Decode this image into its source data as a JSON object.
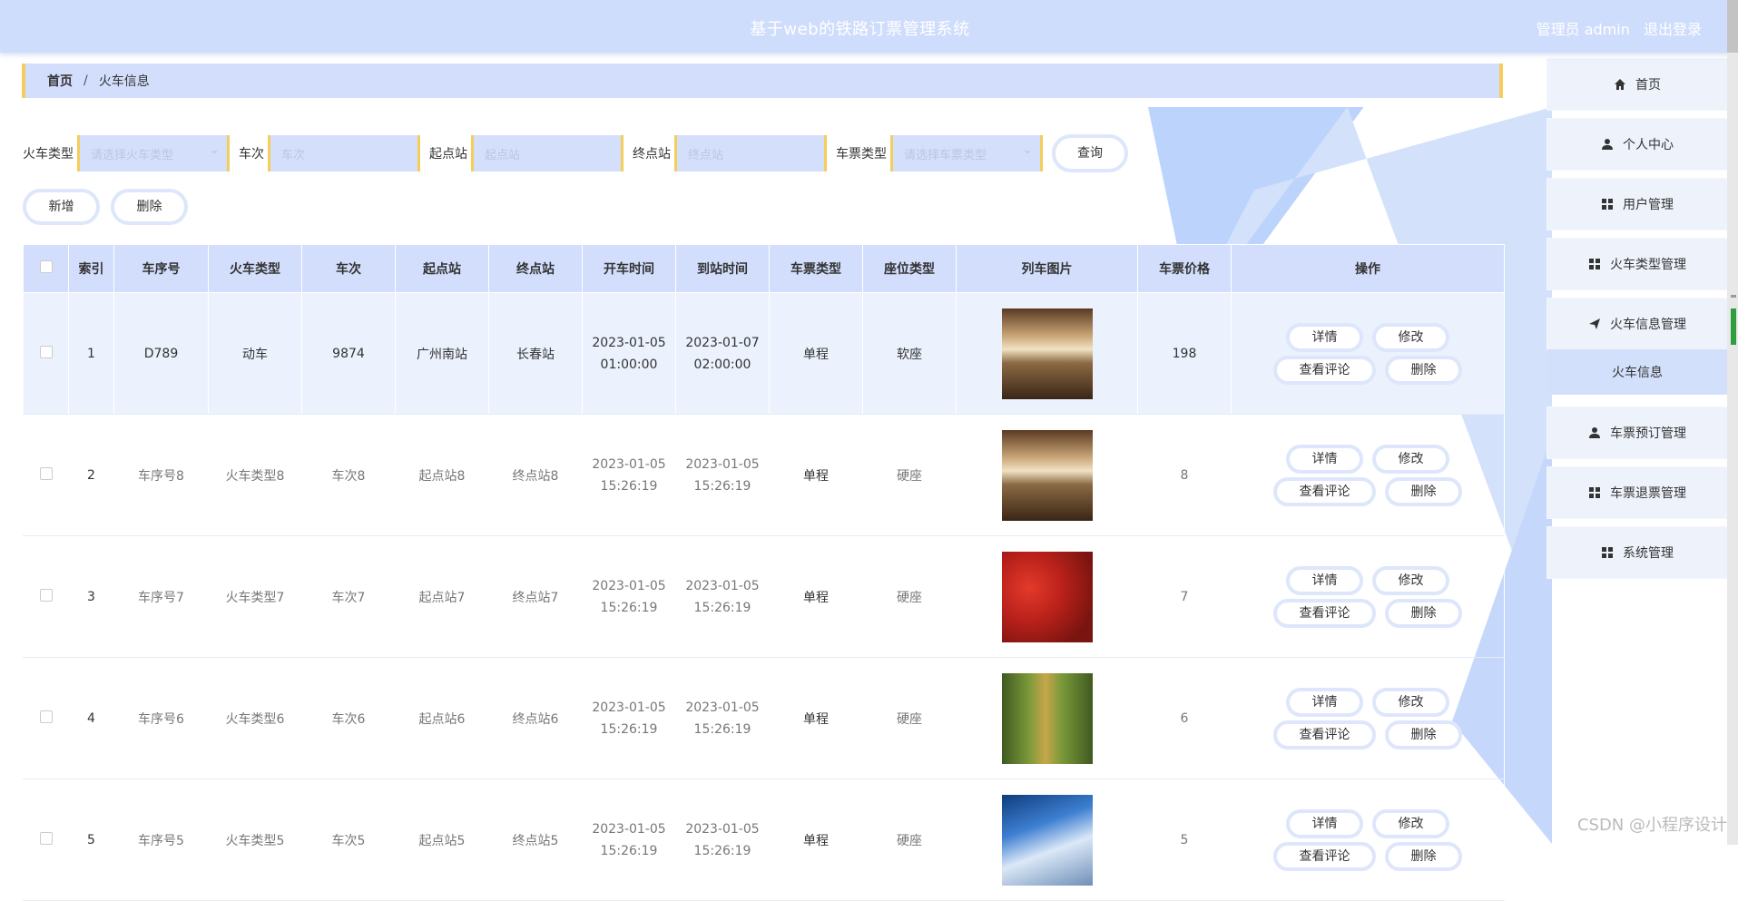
{
  "header": {
    "title": "基于web的铁路订票管理系统",
    "user_label": "管理员 admin",
    "logout_label": "退出登录"
  },
  "breadcrumb": {
    "home": "首页",
    "separator": "/",
    "current": "火车信息"
  },
  "search": {
    "train_type_label": "火车类型",
    "train_type_placeholder": "请选择火车类型",
    "train_no_label": "车次",
    "train_no_placeholder": "车次",
    "start_label": "起点站",
    "start_placeholder": "起点站",
    "end_label": "终点站",
    "end_placeholder": "终点站",
    "ticket_type_label": "车票类型",
    "ticket_type_placeholder": "请选择车票类型",
    "query_label": "查询"
  },
  "actions": {
    "add_label": "新增",
    "delete_label": "删除"
  },
  "table": {
    "headers": [
      "索引",
      "车序号",
      "火车类型",
      "车次",
      "起点站",
      "终点站",
      "开车时间",
      "到站时间",
      "车票类型",
      "座位类型",
      "列车图片",
      "车票价格",
      "操作"
    ],
    "rows": [
      {
        "index": "1",
        "serial": "D789",
        "train_type": "动车",
        "code": "9874",
        "start": "广州南站",
        "end": "长春站",
        "depart_date": "2023-01-05",
        "depart_time": "01:00:00",
        "arrive_date": "2023-01-07",
        "arrive_time": "02:00:00",
        "ticket_type": "单程",
        "seat_type": "软座",
        "image": "train-interior",
        "price": "198"
      },
      {
        "index": "2",
        "serial": "车序号8",
        "train_type": "火车类型8",
        "code": "车次8",
        "start": "起点站8",
        "end": "终点站8",
        "depart_date": "2023-01-05",
        "depart_time": "15:26:19",
        "arrive_date": "2023-01-05",
        "arrive_time": "15:26:19",
        "ticket_type": "单程",
        "seat_type": "硬座",
        "image": "train-interior",
        "price": "8"
      },
      {
        "index": "3",
        "serial": "车序号7",
        "train_type": "火车类型7",
        "code": "车次7",
        "start": "起点站7",
        "end": "终点站7",
        "depart_date": "2023-01-05",
        "depart_time": "15:26:19",
        "arrive_date": "2023-01-05",
        "arrive_time": "15:26:19",
        "ticket_type": "单程",
        "seat_type": "硬座",
        "image": "train-red-forest",
        "price": "7"
      },
      {
        "index": "4",
        "serial": "车序号6",
        "train_type": "火车类型6",
        "code": "车次6",
        "start": "起点站6",
        "end": "终点站6",
        "depart_date": "2023-01-05",
        "depart_time": "15:26:19",
        "arrive_date": "2023-01-05",
        "arrive_time": "15:26:19",
        "ticket_type": "单程",
        "seat_type": "硬座",
        "image": "train-forest-track",
        "price": "6"
      },
      {
        "index": "5",
        "serial": "车序号5",
        "train_type": "火车类型5",
        "code": "车次5",
        "start": "起点站5",
        "end": "终点站5",
        "depart_date": "2023-01-05",
        "depart_time": "15:26:19",
        "arrive_date": "2023-01-05",
        "arrive_time": "15:26:19",
        "ticket_type": "单程",
        "seat_type": "硬座",
        "image": "train-high-speed",
        "price": "5"
      }
    ],
    "ops": {
      "detail": "详情",
      "edit": "修改",
      "comment": "查看评论",
      "delete": "删除"
    }
  },
  "sidebar": {
    "items": [
      {
        "label": "首页",
        "icon": "home-icon"
      },
      {
        "label": "个人中心",
        "icon": "user-icon"
      },
      {
        "label": "用户管理",
        "icon": "grid-icon"
      },
      {
        "label": "火车类型管理",
        "icon": "grid-icon"
      },
      {
        "label": "火车信息管理",
        "icon": "send-icon"
      },
      {
        "label": "车票预订管理",
        "icon": "user-icon"
      },
      {
        "label": "车票退票管理",
        "icon": "grid-icon"
      },
      {
        "label": "系统管理",
        "icon": "grid-icon"
      }
    ],
    "sub_item": "火车信息"
  },
  "watermark": "CSDN @小程序设计",
  "colors": {
    "header": "#cfddfc",
    "accent_border": "#f5cd5b",
    "table_head": "#d2defc"
  }
}
